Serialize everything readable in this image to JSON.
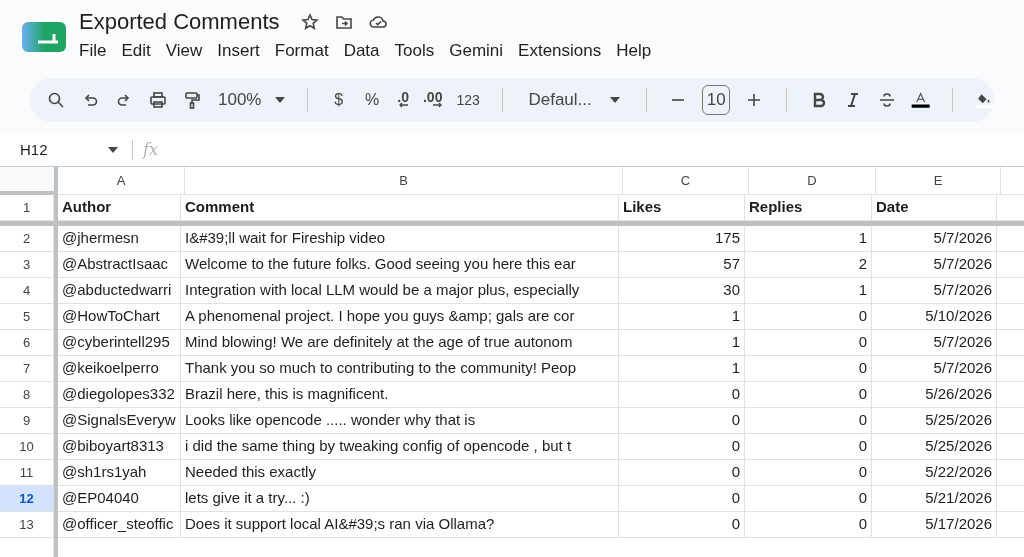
{
  "document": {
    "title": "Exported Comments"
  },
  "menu": [
    "File",
    "Edit",
    "View",
    "Insert",
    "Format",
    "Data",
    "Tools",
    "Gemini",
    "Extensions",
    "Help"
  ],
  "toolbar": {
    "zoom": "100%",
    "currency": "$",
    "percent": "%",
    "decrease_decimal": ".0",
    "increase_decimal": ".00",
    "number_format": "123",
    "font": "Defaul...",
    "font_size": "10"
  },
  "formula_bar": {
    "cell_ref": "H12",
    "fx": "fx"
  },
  "sheet": {
    "columns": [
      "A",
      "B",
      "C",
      "D",
      "E"
    ],
    "header_row": {
      "number": "1",
      "cells": [
        "Author",
        "Comment",
        "Likes",
        "Replies",
        "Date"
      ]
    },
    "rows": [
      {
        "number": "2",
        "selected": false,
        "cells": [
          "@jhermesn",
          "I&#39;ll wait for Fireship video",
          "175",
          "1",
          "5/7/2026"
        ]
      },
      {
        "number": "3",
        "selected": false,
        "cells": [
          "@AbstractIsaac",
          "Welcome to the future folks. Good seeing you here this ear",
          "57",
          "2",
          "5/7/2026"
        ]
      },
      {
        "number": "4",
        "selected": false,
        "cells": [
          "@abductedwarri",
          "Integration with local LLM would be a major plus, especially",
          "30",
          "1",
          "5/7/2026"
        ]
      },
      {
        "number": "5",
        "selected": false,
        "cells": [
          "@HowToChart",
          "A phenomenal project. I hope you guys &amp; gals are cor",
          "1",
          "0",
          "5/10/2026"
        ]
      },
      {
        "number": "6",
        "selected": false,
        "cells": [
          "@cyberintell295",
          "Mind blowing! We are definitely at the age of true autonom",
          "1",
          "0",
          "5/7/2026"
        ]
      },
      {
        "number": "7",
        "selected": false,
        "cells": [
          "@keikoelperro",
          "Thank you so much to contributing to the community! Peop",
          "1",
          "0",
          "5/7/2026"
        ]
      },
      {
        "number": "8",
        "selected": false,
        "cells": [
          "@diegolopes332",
          "Brazil here, this is magnificent.",
          "0",
          "0",
          "5/26/2026"
        ]
      },
      {
        "number": "9",
        "selected": false,
        "cells": [
          "@SignalsEveryw",
          "Looks like opencode ..... wonder why that is",
          "0",
          "0",
          "5/25/2026"
        ]
      },
      {
        "number": "10",
        "selected": false,
        "cells": [
          "@biboyart8313",
          "i did the same thing by tweaking config of opencode , but t",
          "0",
          "0",
          "5/25/2026"
        ]
      },
      {
        "number": "11",
        "selected": false,
        "cells": [
          "@sh1rs1yah",
          "Needed this exactly",
          "0",
          "0",
          "5/22/2026"
        ]
      },
      {
        "number": "12",
        "selected": true,
        "cells": [
          "@EP04040",
          "lets give it a try... :)",
          "0",
          "0",
          "5/21/2026"
        ]
      },
      {
        "number": "13",
        "selected": false,
        "cells": [
          "@officer_steoffic",
          "Does it support local AI&#39;s ran via Ollama?",
          "0",
          "0",
          "5/17/2026"
        ]
      }
    ]
  }
}
